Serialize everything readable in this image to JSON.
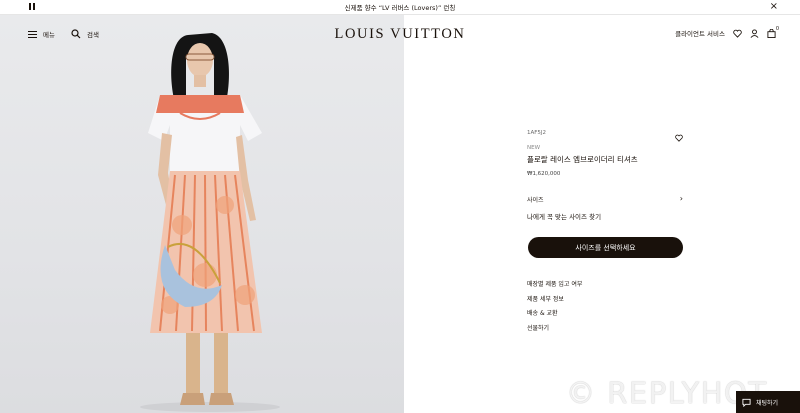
{
  "announcement": {
    "text": "신제품 향수 “LV 러버스 (Lovers)” 런칭"
  },
  "header": {
    "menu_label": "메뉴",
    "search_label": "검색",
    "logo": "LOUIS VUITTON",
    "client_service": "클라이언트 서비스",
    "bag_count": "0"
  },
  "product": {
    "sku": "1AF5J2",
    "badge": "NEW",
    "name": "플로랄 레이스 엠브로이더리 티셔츠",
    "price": "₩1,620,000",
    "size_label": "사이즈",
    "size_finder": "나에게 꼭 맞는 사이즈 찾기",
    "cta": "사이즈를 선택하세요",
    "links": [
      "매장별 제품 입고 여부",
      "제품 세부 정보",
      "배송 & 교환",
      "선물하기"
    ]
  },
  "assistant": {
    "label": "채팅하기"
  },
  "watermark": "© REPLYHOT"
}
